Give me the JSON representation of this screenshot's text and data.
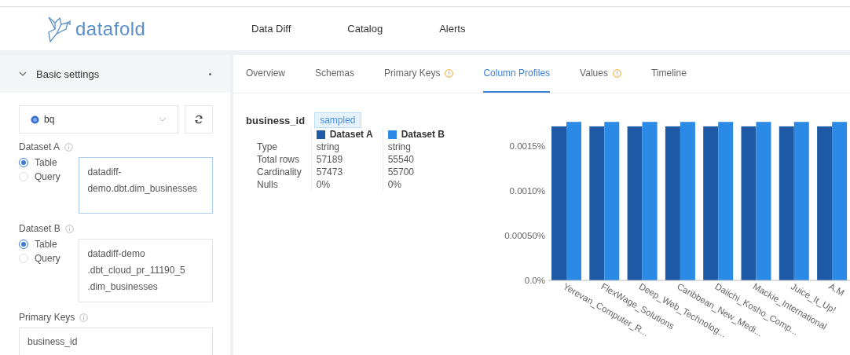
{
  "header": {
    "logo": "datafold",
    "nav": [
      {
        "label": "Data Diff"
      },
      {
        "label": "Catalog"
      },
      {
        "label": "Alerts"
      }
    ]
  },
  "sidebar": {
    "section": {
      "title": "Basic settings",
      "expanded": true
    },
    "source": {
      "value": "bq"
    },
    "datasets": [
      {
        "label": "Dataset A",
        "options": [
          {
            "label": "Table",
            "selected": true
          },
          {
            "label": "Query",
            "selected": false
          }
        ],
        "value": "datadiff-demo.dbt.dim_businesses",
        "focused": true
      },
      {
        "label": "Dataset B",
        "options": [
          {
            "label": "Table",
            "selected": true
          },
          {
            "label": "Query",
            "selected": false
          }
        ],
        "value": "datadiff-demo .dbt_cloud_pr_11190_5 .dim_businesses",
        "focused": false
      }
    ],
    "primary_keys": {
      "label": "Primary Keys",
      "value": "business_id"
    }
  },
  "tabs": [
    {
      "label": "Overview",
      "selected": false,
      "warning": false
    },
    {
      "label": "Schemas",
      "selected": false,
      "warning": false
    },
    {
      "label": "Primary Keys",
      "selected": false,
      "warning": true
    },
    {
      "label": "Column Profiles",
      "selected": true,
      "warning": false
    },
    {
      "label": "Values",
      "selected": false,
      "warning": true
    },
    {
      "label": "Timeline",
      "selected": false,
      "warning": false
    }
  ],
  "profile": {
    "column": "business_id",
    "badge": "sampled",
    "rows": [
      {
        "label": "Type",
        "a": "string",
        "b": "string"
      },
      {
        "label": "Total rows",
        "a": "57189",
        "b": "55540"
      },
      {
        "label": "Cardinality",
        "a": "57473",
        "b": "55700"
      },
      {
        "label": "Nulls",
        "a": "0%",
        "b": "0%"
      }
    ],
    "chart_data": {
      "type": "bar",
      "categories": [
        "Yerevan_Computer_R...",
        "FlexWage_Solutions",
        "Deep_Web_Technolog...",
        "Caribbean_New_Medi...",
        "Daiichi_Kosho_Comp...",
        "Mackie_International",
        "Juice_It_Up!",
        "A.M"
      ],
      "series": [
        {
          "name": "Dataset A",
          "color": "#1f5aa6",
          "values": [
            0.00172,
            0.00172,
            0.00172,
            0.00172,
            0.00172,
            0.00172,
            0.00172,
            0.00172
          ]
        },
        {
          "name": "Dataset B",
          "color": "#2b8ae6",
          "values": [
            0.00177,
            0.00177,
            0.00177,
            0.00177,
            0.00177,
            0.00177,
            0.00177,
            0.00177
          ]
        }
      ],
      "ylim": [
        0,
        0.0018
      ],
      "yticks": [
        {
          "value": 0,
          "label": "0.0%"
        },
        {
          "value": 0.0005,
          "label": "0.00050%"
        },
        {
          "value": 0.001,
          "label": "0.0010%"
        },
        {
          "value": 0.0015,
          "label": "0.0015%"
        }
      ]
    }
  }
}
